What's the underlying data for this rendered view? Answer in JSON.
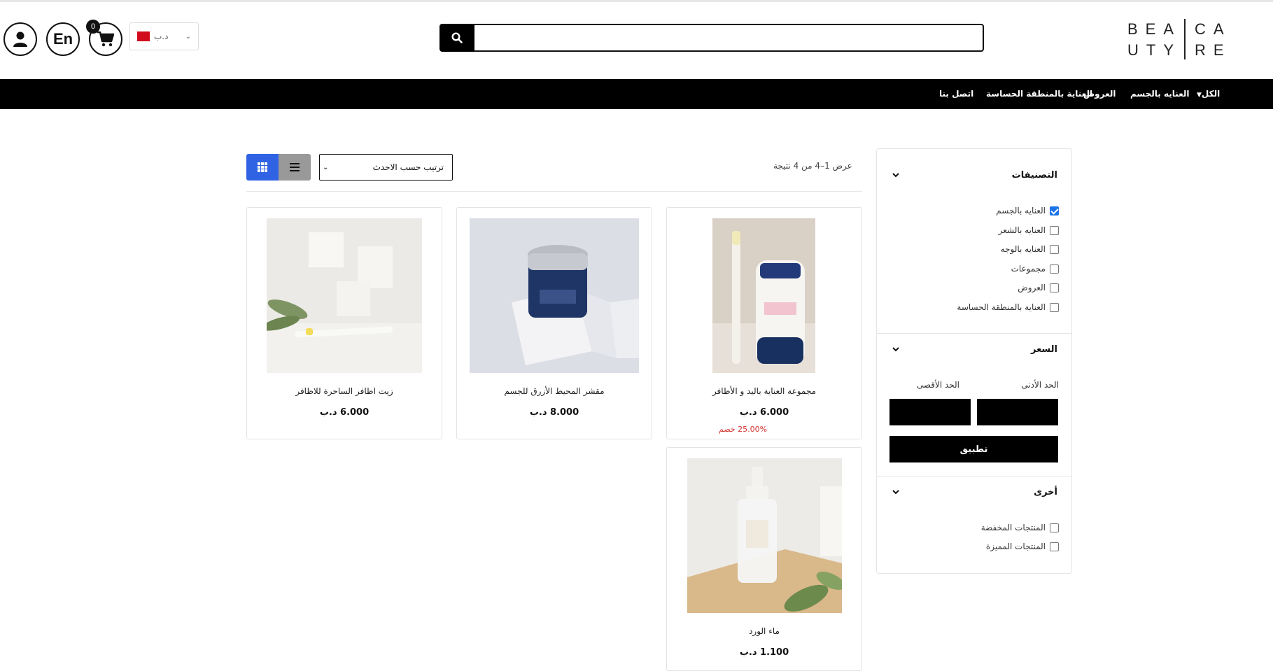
{
  "header": {
    "cart_count": "0",
    "lang_label": "En",
    "currency": "د.ب",
    "search_placeholder": "",
    "logo": {
      "left_top": "BEA",
      "left_bottom": "UTY",
      "right_top": "CA",
      "right_bottom": "RE"
    }
  },
  "nav": {
    "items": [
      {
        "label": "الكل"
      },
      {
        "label": "العنايه بالجسم"
      },
      {
        "label": "العروض"
      },
      {
        "label": "العناية بالمنطقة الحساسة"
      },
      {
        "label": "اتصل بنا"
      }
    ]
  },
  "sidebar": {
    "categories": {
      "title": "التصنيفات",
      "items": [
        {
          "label": "العنايه بالجسم",
          "checked": true
        },
        {
          "label": "العنايه بالشعر",
          "checked": false
        },
        {
          "label": "العنايه بالوجه",
          "checked": false
        },
        {
          "label": "مجموعات",
          "checked": false
        },
        {
          "label": "العروض",
          "checked": false
        },
        {
          "label": "العناية بالمنطقة الحساسة",
          "checked": false
        }
      ]
    },
    "price": {
      "title": "السعر",
      "min_label": "الحد الأدنى",
      "max_label": "الحد الأقصى",
      "apply_label": "تطبيق"
    },
    "other": {
      "title": "أخرى",
      "items": [
        {
          "label": "المنتجات المخفضة",
          "checked": false
        },
        {
          "label": "المنتجات المميزة",
          "checked": false
        }
      ]
    }
  },
  "toolbar": {
    "result_count": "عرض 1–4 من 4 نتيجة",
    "sort_label": "ترتيب حسب الاحدث"
  },
  "products": [
    {
      "title": "مجموعة العناية باليد و الأظافر",
      "price": "6.000 د.ب",
      "discount": "25.00% خصم",
      "image": "vaseline-and-nail-pen"
    },
    {
      "title": "مقشر المحيط الأزرق للجسم",
      "price": "8.000 د.ب",
      "image": "ocean-motion-jar"
    },
    {
      "title": "زيت اظافر الساحرة للاظافر",
      "price": "6.000 د.ب",
      "image": "witch-nails-pen"
    },
    {
      "title": "ماء الورد",
      "price": "1.100 د.ب",
      "image": "rose-water-bottle"
    }
  ],
  "colors": {
    "accent": "#2f63e3",
    "nav_bg": "#000000",
    "discount": "#d0312d"
  }
}
